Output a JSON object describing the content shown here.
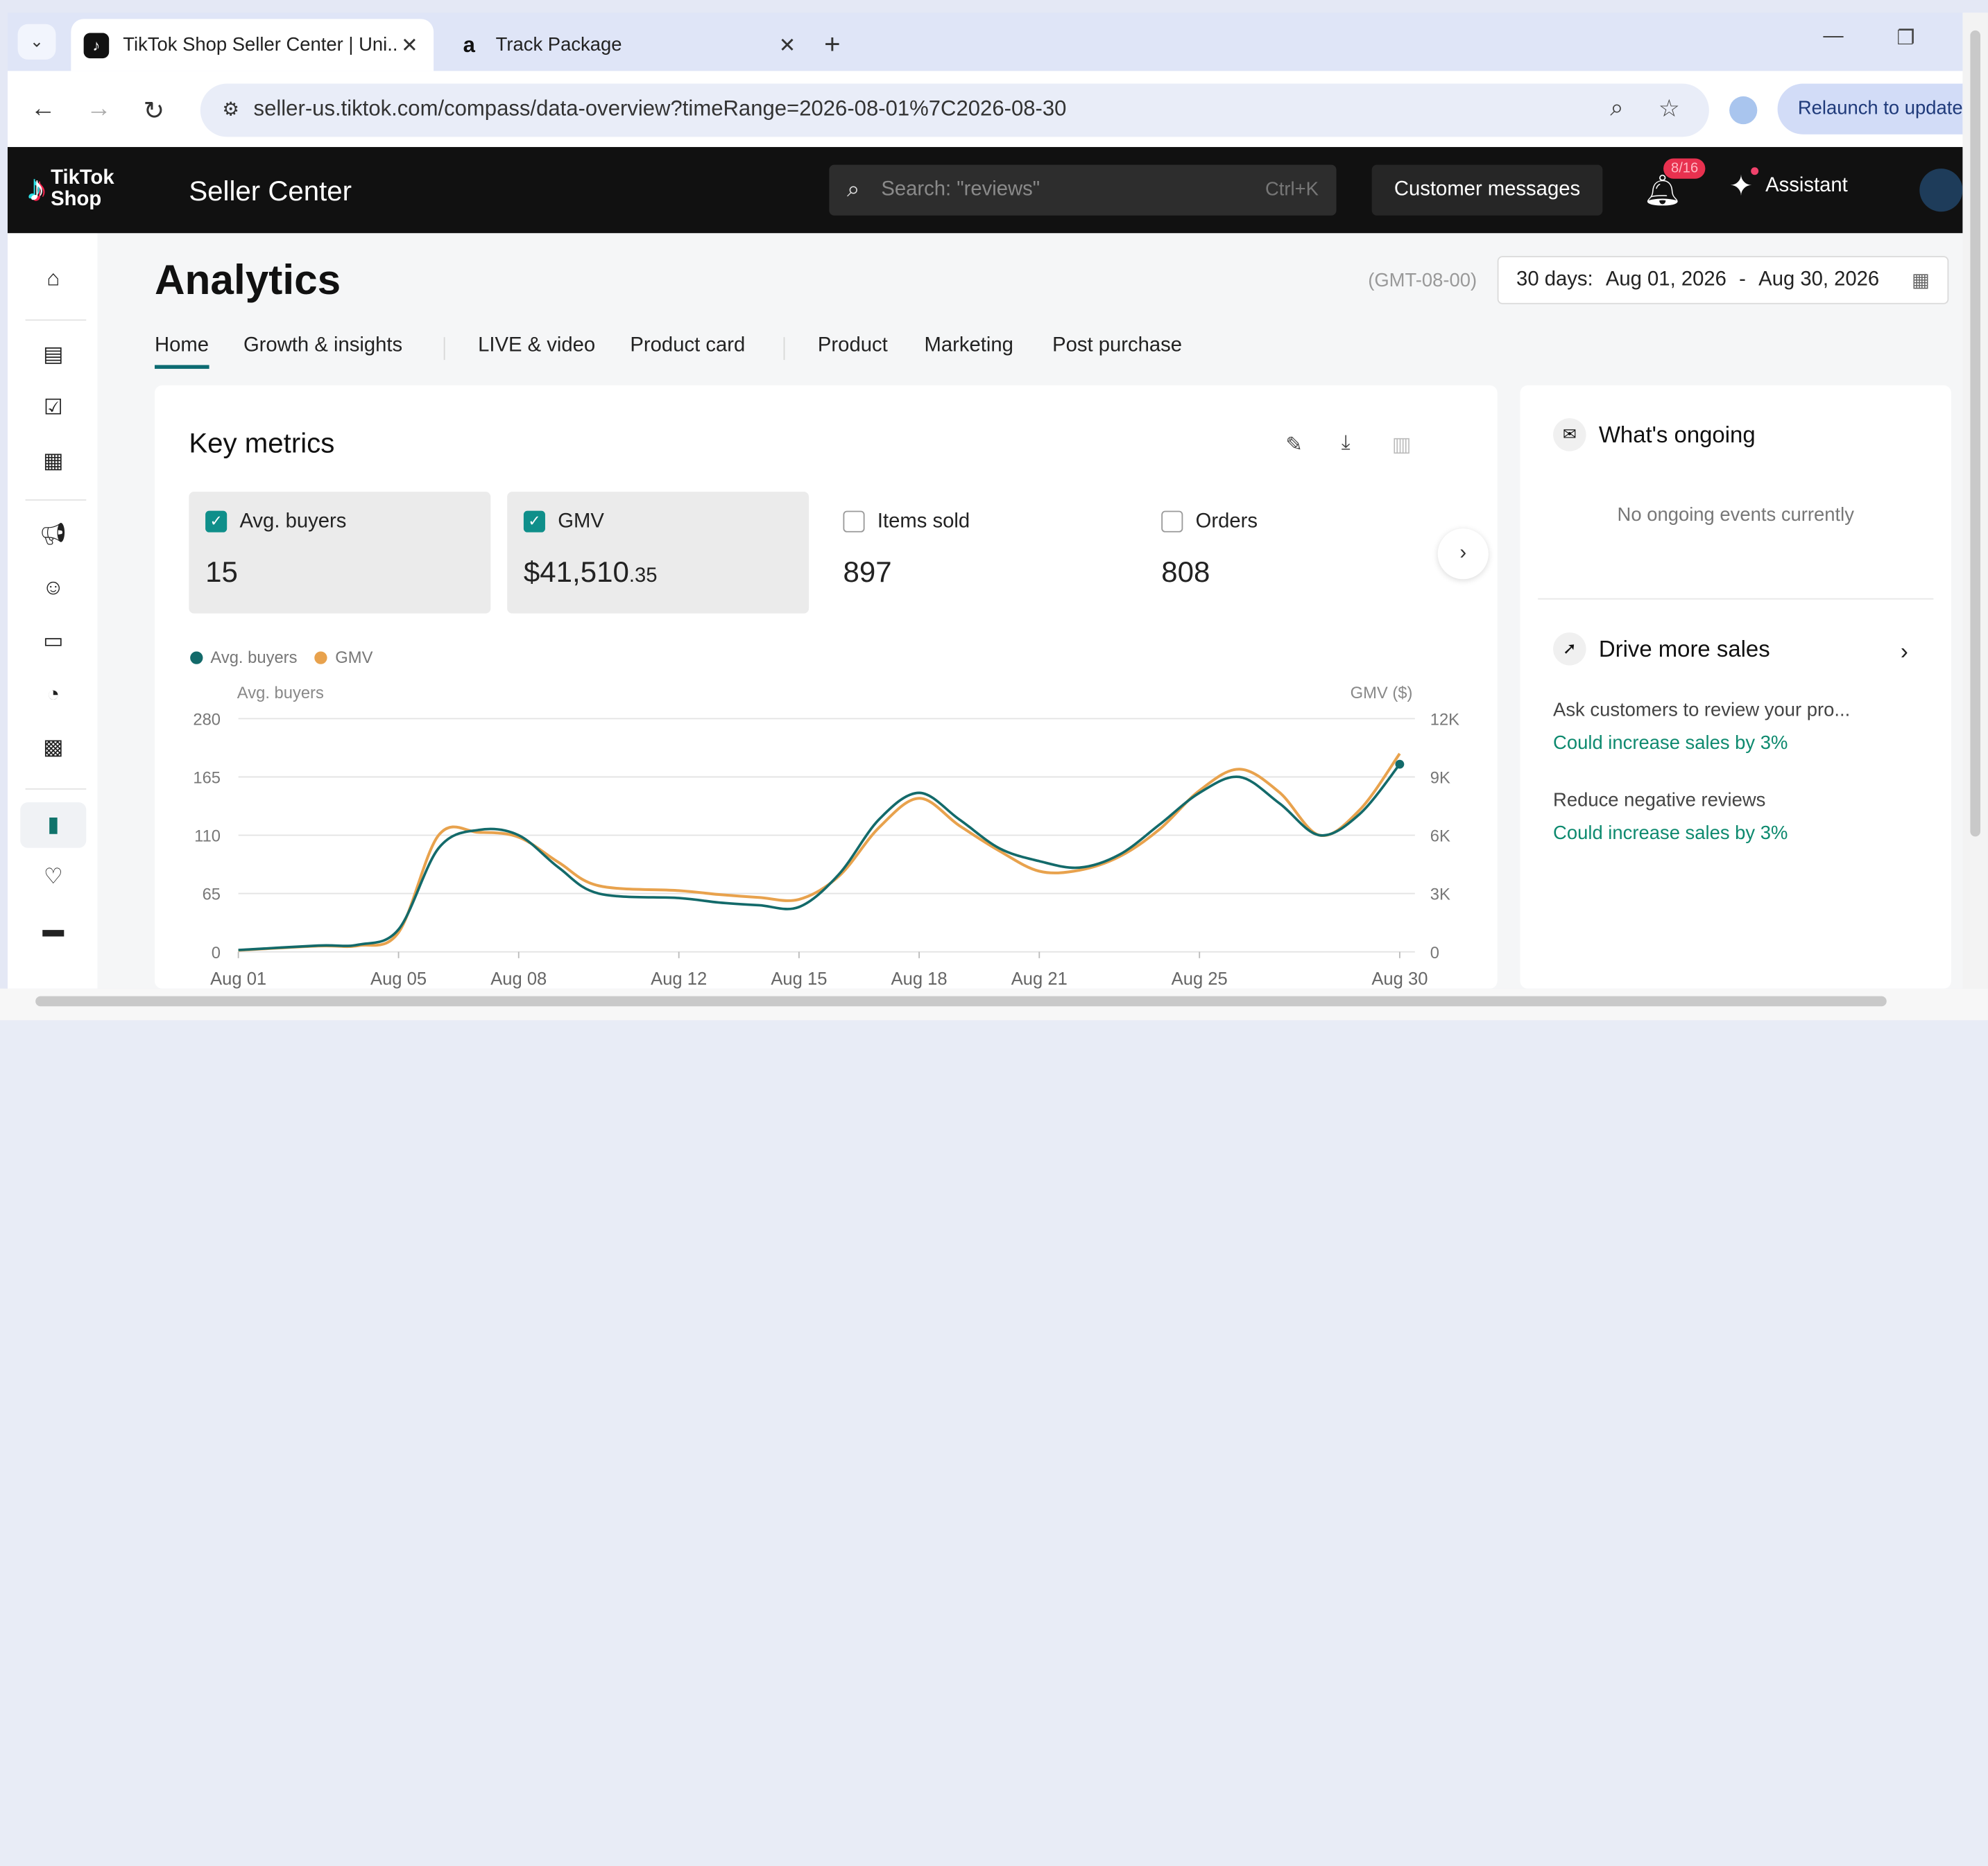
{
  "browser": {
    "tabs": [
      {
        "title": "TikTok Shop Seller Center | Uni...",
        "favicon": "tiktok-icon",
        "active": true
      },
      {
        "title": "Track Package",
        "favicon": "a",
        "active": false
      }
    ],
    "url": "seller-us.tiktok.com/compass/data-overview?timeRange=2026-08-01%7C2026-08-30",
    "relaunch_label": "Relaunch to update"
  },
  "header": {
    "logo_line1": "TikTok",
    "logo_line2": "Shop",
    "title": "Seller Center",
    "search_placeholder": "Search: \"reviews\"",
    "search_shortcut": "Ctrl+K",
    "customer_messages": "Customer messages",
    "notification_badge": "8/16",
    "assistant": "Assistant"
  },
  "page": {
    "title": "Analytics",
    "timezone": "(GMT-08-00)",
    "date_prefix": "30 days:",
    "date_start": "Aug 01, 2026",
    "date_sep": "-",
    "date_end": "Aug 30, 2026",
    "tabs": [
      "Home",
      "Growth & insights",
      "LIVE & video",
      "Product card",
      "Product",
      "Marketing",
      "Post purchase"
    ]
  },
  "key_metrics": {
    "title": "Key metrics",
    "metrics": [
      {
        "label": "Avg. buyers",
        "value": "15",
        "value_small": "",
        "checked": true
      },
      {
        "label": "GMV",
        "value": "$41,510",
        "value_small": ".35",
        "checked": true
      },
      {
        "label": "Items sold",
        "value": "897",
        "value_small": "",
        "checked": false
      },
      {
        "label": "Orders",
        "value": "808",
        "value_small": "",
        "checked": false
      }
    ]
  },
  "chart_data": {
    "type": "line",
    "legend": [
      "Avg. buyers",
      "GMV"
    ],
    "left_axis_label": "Avg. buyers",
    "right_axis_label": "GMV ($)",
    "left_ticks": [
      "0",
      "65",
      "110",
      "165",
      "280"
    ],
    "right_ticks": [
      "0",
      "3K",
      "6K",
      "9K",
      "12K"
    ],
    "x_ticks": [
      "Aug 01",
      "Aug 05",
      "Aug 08",
      "Aug 12",
      "Aug 15",
      "Aug 18",
      "Aug 21",
      "Aug 25",
      "Aug 30"
    ],
    "colors": {
      "buyers": "#136a6a",
      "gmv": "#e8a24d"
    },
    "series": [
      {
        "name": "Avg. buyers",
        "x": [
          1,
          3,
          4,
          5,
          6,
          7,
          8,
          9,
          10,
          12,
          13,
          14,
          15,
          16,
          17,
          18,
          19,
          20,
          21,
          22,
          23,
          24,
          25,
          26,
          27,
          28,
          29,
          30
        ],
        "y": [
          2,
          7,
          8,
          25,
          100,
          115,
          110,
          85,
          65,
          60,
          55,
          52,
          50,
          80,
          125,
          150,
          125,
          100,
          90,
          85,
          95,
          120,
          150,
          165,
          140,
          110,
          130,
          190
        ]
      },
      {
        "name": "GMV",
        "x": [
          1,
          3,
          4,
          5,
          6,
          7,
          8,
          9,
          10,
          12,
          13,
          14,
          15,
          16,
          17,
          18,
          19,
          20,
          21,
          22,
          23,
          24,
          25,
          26,
          27,
          28,
          29,
          30
        ],
        "y": [
          80,
          300,
          320,
          1000,
          6000,
          6150,
          5900,
          4600,
          3400,
          3150,
          2950,
          2800,
          2700,
          3900,
          6400,
          7900,
          6500,
          5200,
          4150,
          4200,
          4900,
          6300,
          8300,
          9400,
          8200,
          6000,
          7300,
          10200
        ]
      }
    ]
  },
  "ongoing": {
    "title": "What's ongoing",
    "empty": "No ongoing events currently"
  },
  "drive_sales": {
    "title": "Drive more sales",
    "items": [
      {
        "text": "Ask customers to review your pro...",
        "impact": "Could increase sales by 3%"
      },
      {
        "text": "Reduce negative reviews",
        "impact": "Could increase sales by 3%"
      }
    ]
  }
}
